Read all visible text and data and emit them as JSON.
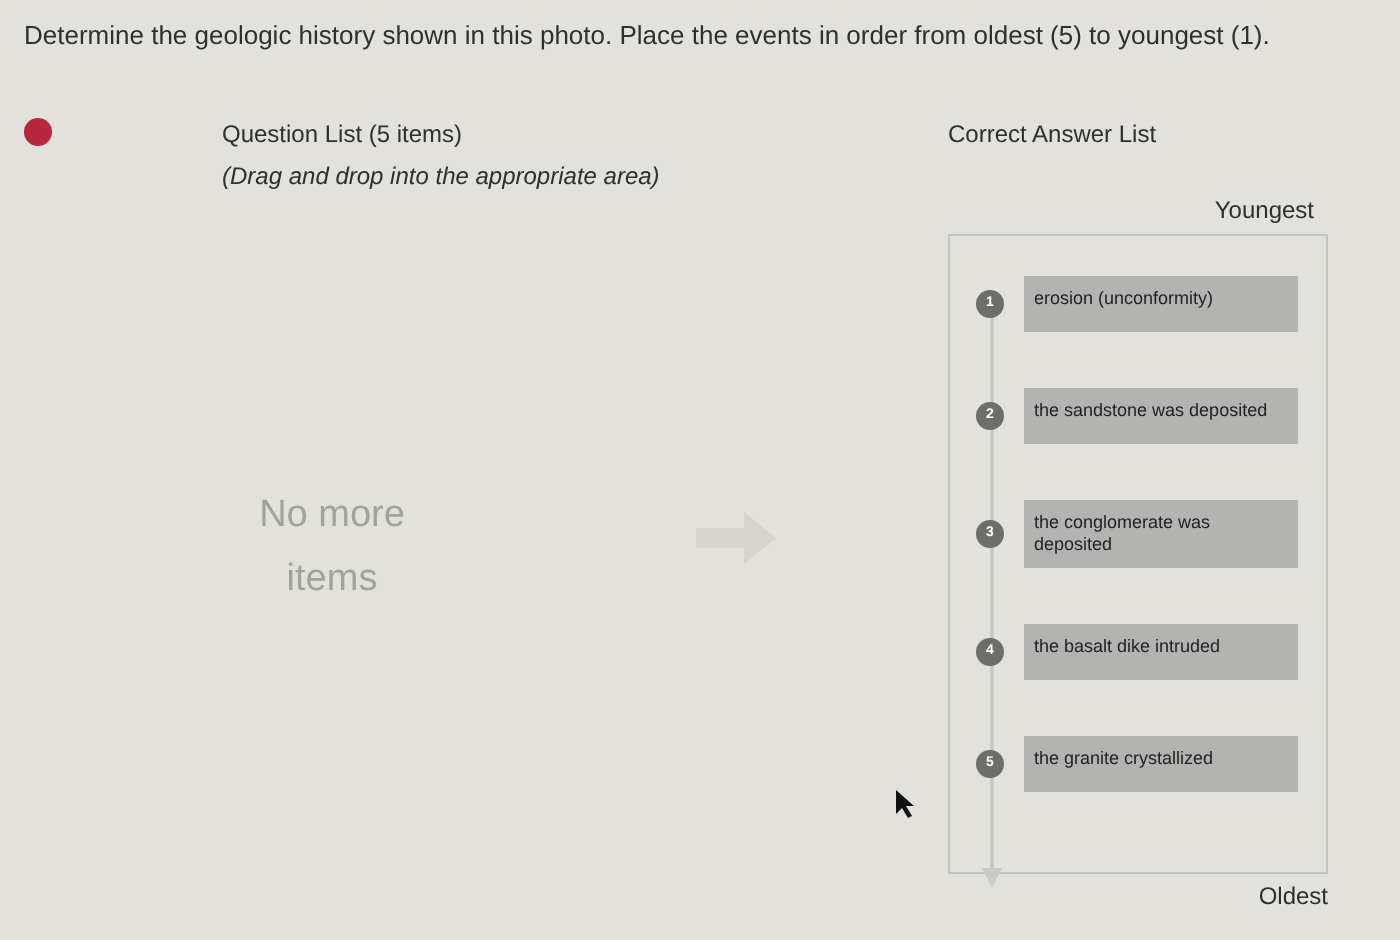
{
  "instruction": "Determine the geologic history shown in this photo. Place the events in order from oldest (5) to youngest (1).",
  "status": {
    "correct": false
  },
  "question_list": {
    "title": "Question List (5 items)",
    "hint": "(Drag and drop into the appropriate area)",
    "empty_text": "No more items"
  },
  "answer_list": {
    "title": "Correct Answer List",
    "top_label": "Youngest",
    "bottom_label": "Oldest",
    "items": [
      {
        "number": "1",
        "text": "erosion (unconformity)"
      },
      {
        "number": "2",
        "text": "the sandstone was deposited"
      },
      {
        "number": "3",
        "text": "the conglomerate was deposited"
      },
      {
        "number": "4",
        "text": "the basalt dike intruded"
      },
      {
        "number": "5",
        "text": "the granite crystallized"
      }
    ]
  }
}
